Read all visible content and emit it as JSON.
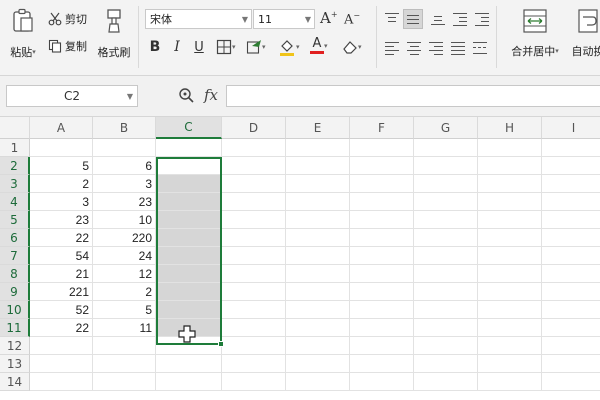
{
  "ribbon": {
    "paste_label": "粘贴",
    "cut_label": "剪切",
    "copy_label": "复制",
    "format_painter_label": "格式刷",
    "font_name": "宋体",
    "font_size": "11",
    "grow_font": "A",
    "shrink_font": "A",
    "bold": "B",
    "italic": "I",
    "underline": "U",
    "font_color_glyph": "A",
    "merge_center_label": "合并居中",
    "auto_wrap_label": "自动换"
  },
  "formula_bar": {
    "name_box": "C2",
    "fx_label": "fx",
    "formula": ""
  },
  "columns": [
    "A",
    "B",
    "C",
    "D",
    "E",
    "F",
    "G",
    "H",
    "I"
  ],
  "active_column": "C",
  "rows": [
    "1",
    "2",
    "3",
    "4",
    "5",
    "6",
    "7",
    "8",
    "9",
    "10",
    "11",
    "12",
    "13",
    "14"
  ],
  "selection": "C2:C11",
  "cells": {
    "A2": "5",
    "B2": "6",
    "A3": "2",
    "B3": "3",
    "A4": "3",
    "B4": "23",
    "A5": "23",
    "B5": "10",
    "A6": "22",
    "B6": "220",
    "A7": "54",
    "B7": "24",
    "A8": "21",
    "B8": "12",
    "A9": "221",
    "B9": "2",
    "A10": "52",
    "B10": "5",
    "A11": "22",
    "B11": "11"
  },
  "colors": {
    "selection_border": "#1e7c3a",
    "selection_fill": "#d6d6d6",
    "header_bg": "#f3f3f3"
  }
}
